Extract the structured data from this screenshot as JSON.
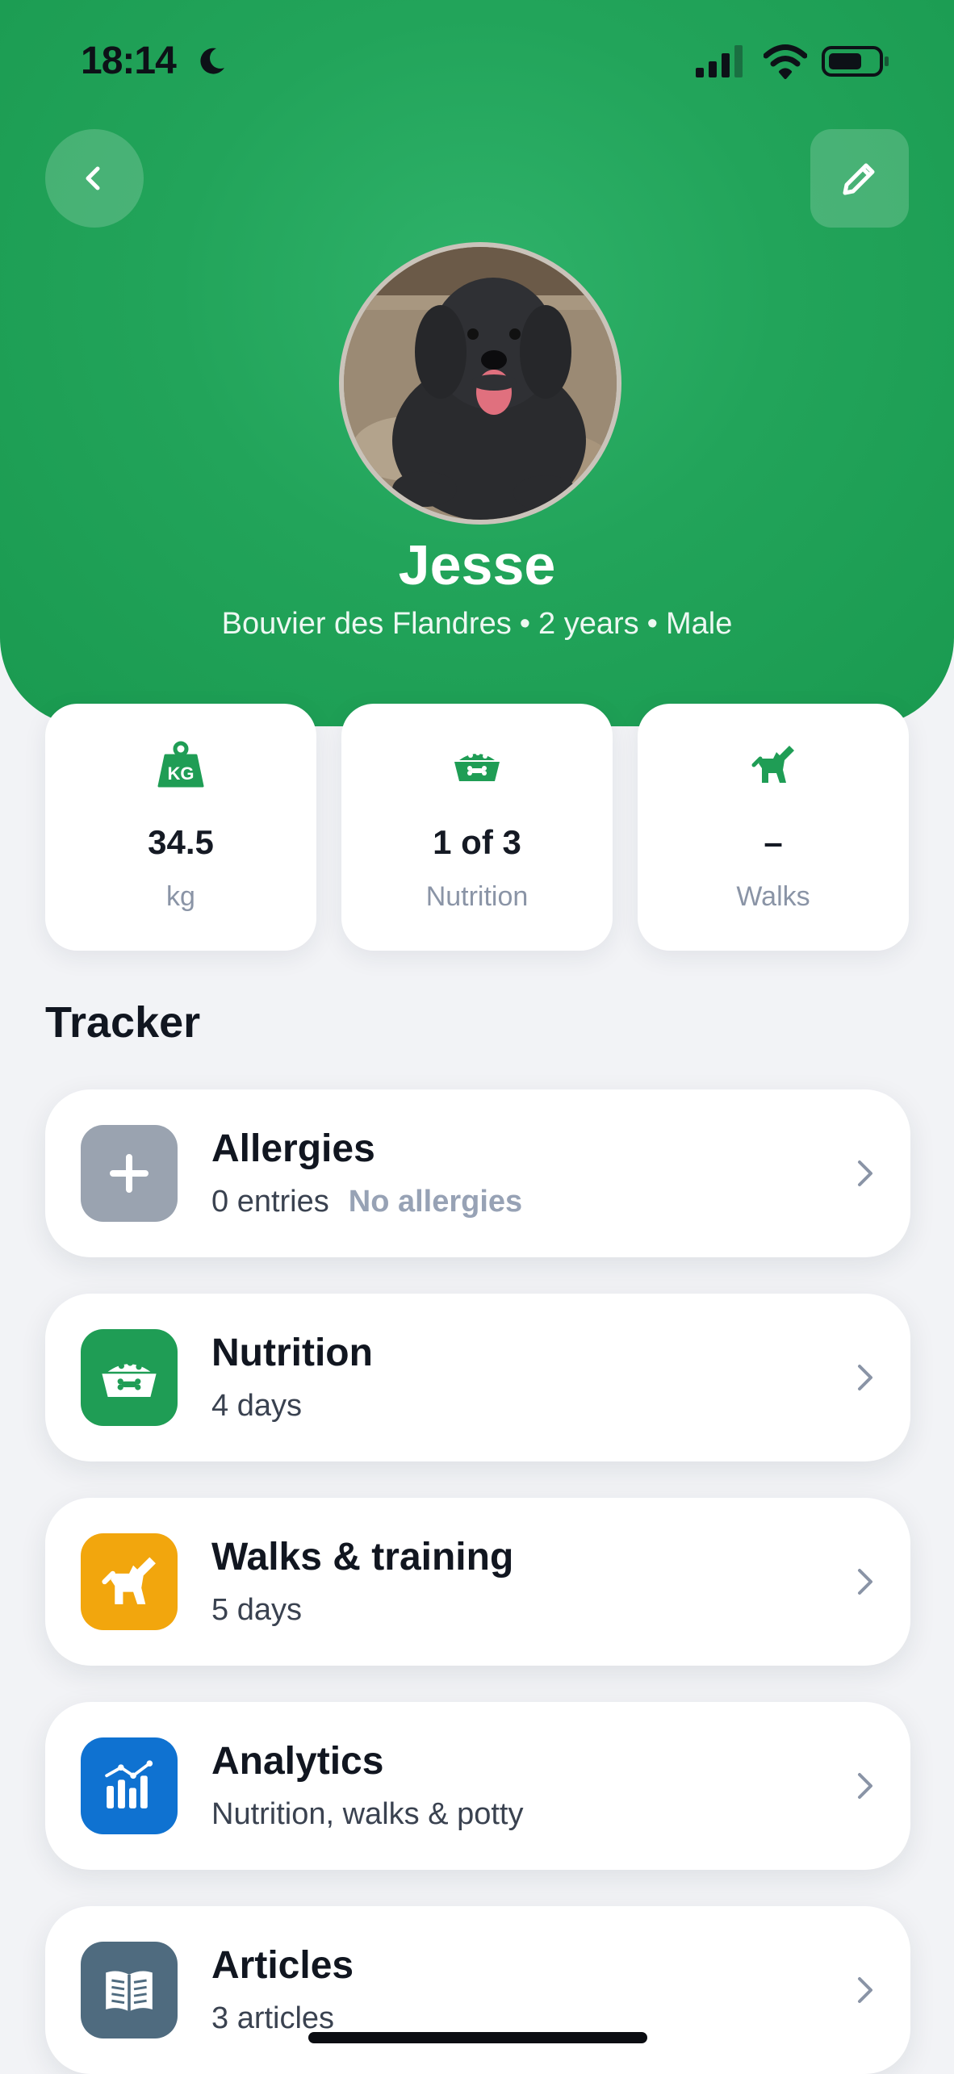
{
  "status_bar": {
    "time": "18:14"
  },
  "profile": {
    "name": "Jesse",
    "breed": "Bouvier des Flandres",
    "age": "2 years",
    "sex": "Male",
    "separator": "•"
  },
  "stats": [
    {
      "icon": "weight-kg-icon",
      "value": "34.5",
      "label": "kg"
    },
    {
      "icon": "food-bowl-icon",
      "value": "1 of 3",
      "label": "Nutrition"
    },
    {
      "icon": "dog-walk-icon",
      "value": "–",
      "label": "Walks"
    }
  ],
  "tracker": {
    "title": "Tracker",
    "items": [
      {
        "title": "Allergies",
        "subtitle": "0 entries",
        "note": "No allergies",
        "icon": "plus-icon",
        "color": "#9aa3b0"
      },
      {
        "title": "Nutrition",
        "subtitle": "4 days",
        "icon": "food-bowl-icon",
        "color": "#1f9d55"
      },
      {
        "title": "Walks & training",
        "subtitle": "5 days",
        "icon": "dog-icon",
        "color": "#f2a60d"
      },
      {
        "title": "Analytics",
        "subtitle": "Nutrition, walks & potty",
        "icon": "bar-chart-icon",
        "color": "#0f72d1"
      },
      {
        "title": "Articles",
        "subtitle": "3 articles",
        "icon": "book-icon",
        "color": "#4f6b7f"
      }
    ]
  },
  "colors": {
    "header_green": "#22a45a",
    "icon_green": "#1f9d55"
  }
}
